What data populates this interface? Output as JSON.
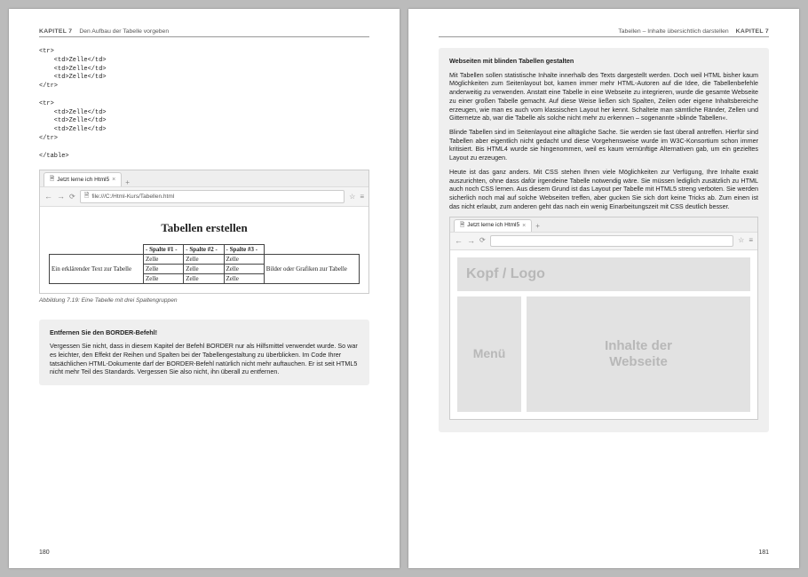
{
  "chapter_label": "Kapitel 7",
  "left_subtitle": "Den Aufbau der Tabelle vorgeben",
  "right_subtitle": "Tabellen – Inhalte übersichtlich darstellen",
  "code_block": "<tr>\n    <td>Zelle</td>\n    <td>Zelle</td>\n    <td>Zelle</td>\n</tr>\n\n<tr>\n    <td>Zelle</td>\n    <td>Zelle</td>\n    <td>Zelle</td>\n</tr>\n\n</table>",
  "browser1": {
    "tab_label": "Jetzt lerne ich Html5",
    "url": "file:///C:/Html-Kurs/Tabellen.html",
    "heading": "Tabellen erstellen",
    "row_left": "Ein erklärender Text zur Tabelle",
    "row_right": "Bilder oder Grafiken zur Tabelle",
    "cols": [
      "- Spalte #1 -",
      "- Spalte #2 -",
      "- Spalte #3 -"
    ],
    "cell": "Zelle"
  },
  "caption": "Abbildung 7.19:  Eine Tabelle mit drei Spaltengruppen",
  "note": {
    "title": "Entfernen Sie den BORDER-Befehl!",
    "body": "Vergessen Sie nicht, dass in diesem Kapitel der Befehl BORDER nur als Hilfsmittel verwendet wurde. So war es leichter, den Effekt der Reihen und Spalten bei der Tabellengestaltung zu überblicken. Im Code Ihrer tatsächlichen HTML-Dokumente darf der BORDER-Befehl natürlich nicht mehr auftauchen. Er ist seit HTML5 nicht mehr Teil des Standards. Vergessen Sie also nicht, ihn überall zu entfernen."
  },
  "article": {
    "title": "Webseiten mit blinden Tabellen gestalten",
    "p1": "Mit Tabellen sollen statistische Inhalte innerhalb des Texts dargestellt werden. Doch weil HTML bisher kaum Möglichkeiten zum Seitenlayout bot, kamen immer mehr HTML-Autoren auf die Idee, die Tabellenbefehle anderweitig zu verwenden. Anstatt eine Tabelle in eine Webseite zu integrieren, wurde die gesamte Webseite zu einer großen Tabelle gemacht. Auf diese Weise ließen sich Spalten, Zeilen oder eigene Inhaltsbereiche erzeugen, wie man es auch vom klassischen Layout her kennt. Schaltete man sämtliche Ränder, Zellen und Gitternetze ab, war die Tabelle als solche nicht mehr zu erkennen – sogenannte »blinde Tabellen«.",
    "p2": "Blinde Tabellen sind im Seitenlayout eine alltägliche Sache. Sie werden sie fast überall antreffen. Hierfür sind Tabellen aber eigentlich nicht gedacht und diese Vorgehensweise wurde im W3C-Konsortium schon immer kritisiert. Bis HTML4 wurde sie hingenommen, weil es kaum vernünftige Alternativen gab, um ein gezieltes Layout zu erzeugen.",
    "p3": "Heute ist das ganz anders. Mit CSS stehen Ihnen viele Möglichkeiten zur Verfügung, Ihre Inhalte exakt auszurichten, ohne dass dafür irgendeine Tabelle notwendig wäre. Sie müssen lediglich zusätzlich zu HTML auch noch CSS lernen. Aus diesem Grund ist das Layout per Tabelle mit HTML5 streng verboten. Sie werden sicherlich noch mal auf solche Webseiten treffen, aber gucken Sie sich dort keine Tricks ab. Zum einen ist das nicht erlaubt, zum anderen geht das nach ein wenig Einarbeitungszeit mit CSS deutlich besser."
  },
  "browser2": {
    "tab_label": "Jetzt lerne ich Html5",
    "wire_top": "Kopf / Logo",
    "wire_menu": "Menü",
    "wire_content_l1": "Inhalte der",
    "wire_content_l2": "Webseite"
  },
  "page_left": "180",
  "page_right": "181",
  "icons": {
    "doc": "🗎",
    "close": "×",
    "plus": "+",
    "back": "←",
    "fwd": "→",
    "reload": "⟳",
    "star": "☆",
    "menu": "≡"
  }
}
